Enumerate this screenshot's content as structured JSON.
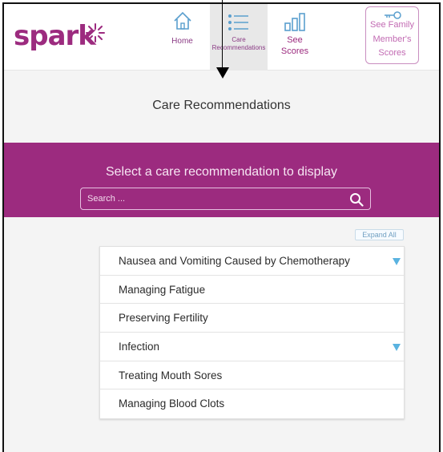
{
  "app": {
    "logo_text": "spark",
    "brand_color": "#9c2b7f",
    "accent_color": "#5ab3e0"
  },
  "nav": {
    "home": {
      "label": "Home",
      "icon": "home-icon"
    },
    "care": {
      "label": "Care Recommendations",
      "icon": "list-icon"
    },
    "scores": {
      "label": "See Scores",
      "icon": "bar-chart-icon"
    },
    "family": {
      "label": "See Family Member's Scores",
      "icon": "key-icon"
    }
  },
  "page": {
    "title": "Care Recommendations"
  },
  "banner": {
    "heading": "Select a care recommendation to display",
    "search_placeholder": "Search ..."
  },
  "expand_all_label": "Expand All",
  "recommendations": [
    {
      "label": "Nausea and Vomiting Caused by Chemotherapy",
      "expandable": true
    },
    {
      "label": "Managing Fatigue",
      "expandable": false
    },
    {
      "label": "Preserving Fertility",
      "expandable": false
    },
    {
      "label": "Infection",
      "expandable": true
    },
    {
      "label": "Treating Mouth Sores",
      "expandable": false
    },
    {
      "label": "Managing Blood Clots",
      "expandable": false
    }
  ]
}
